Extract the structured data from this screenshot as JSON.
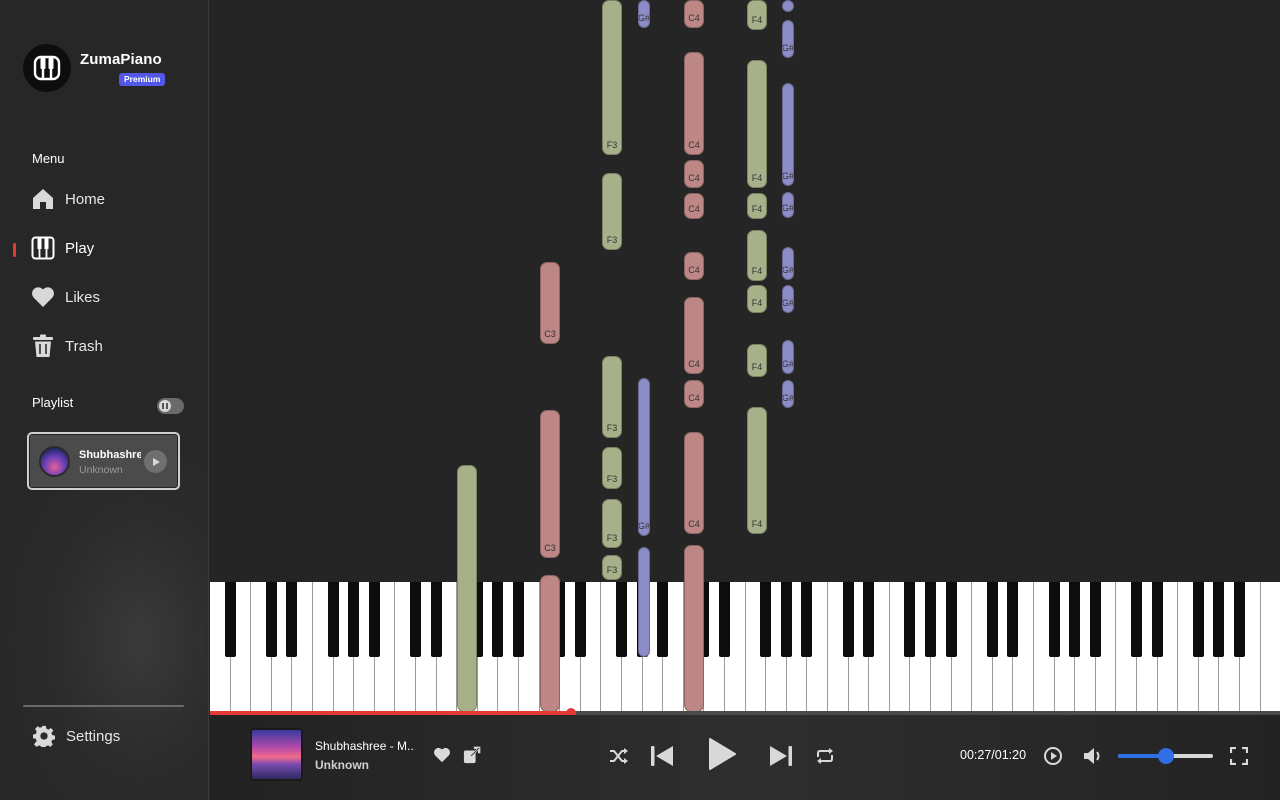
{
  "app": {
    "brand": "ZumaPiano",
    "badge": "Premium"
  },
  "menu": {
    "label": "Menu",
    "items": [
      {
        "label": "Home",
        "icon": "home-icon"
      },
      {
        "label": "Play",
        "icon": "piano-icon",
        "active": true
      },
      {
        "label": "Likes",
        "icon": "heart-icon"
      },
      {
        "label": "Trash",
        "icon": "trash-icon"
      }
    ]
  },
  "playlist": {
    "label": "Playlist",
    "toggle_state": "paused",
    "items": [
      {
        "title": "Shubhashree - M",
        "artist": "Unknown"
      }
    ]
  },
  "settings": {
    "label": "Settings",
    "icon": "gear-icon"
  },
  "notes": {
    "labels": [
      "C3",
      "F3",
      "G#",
      "C4",
      "F4"
    ],
    "colors": {
      "green": "#a7b189",
      "red": "#bd8785",
      "blue": "#8c8cc6"
    }
  },
  "player": {
    "title": "Shubhashree - M...",
    "artist": "Unknown",
    "elapsed": "00:27",
    "duration": "01:20",
    "time_display": "00:27/01:20",
    "progress_fraction": 0.3375,
    "volume_fraction": 0.5,
    "accent": "#e53935",
    "volume_color": "#2f6fe4"
  }
}
